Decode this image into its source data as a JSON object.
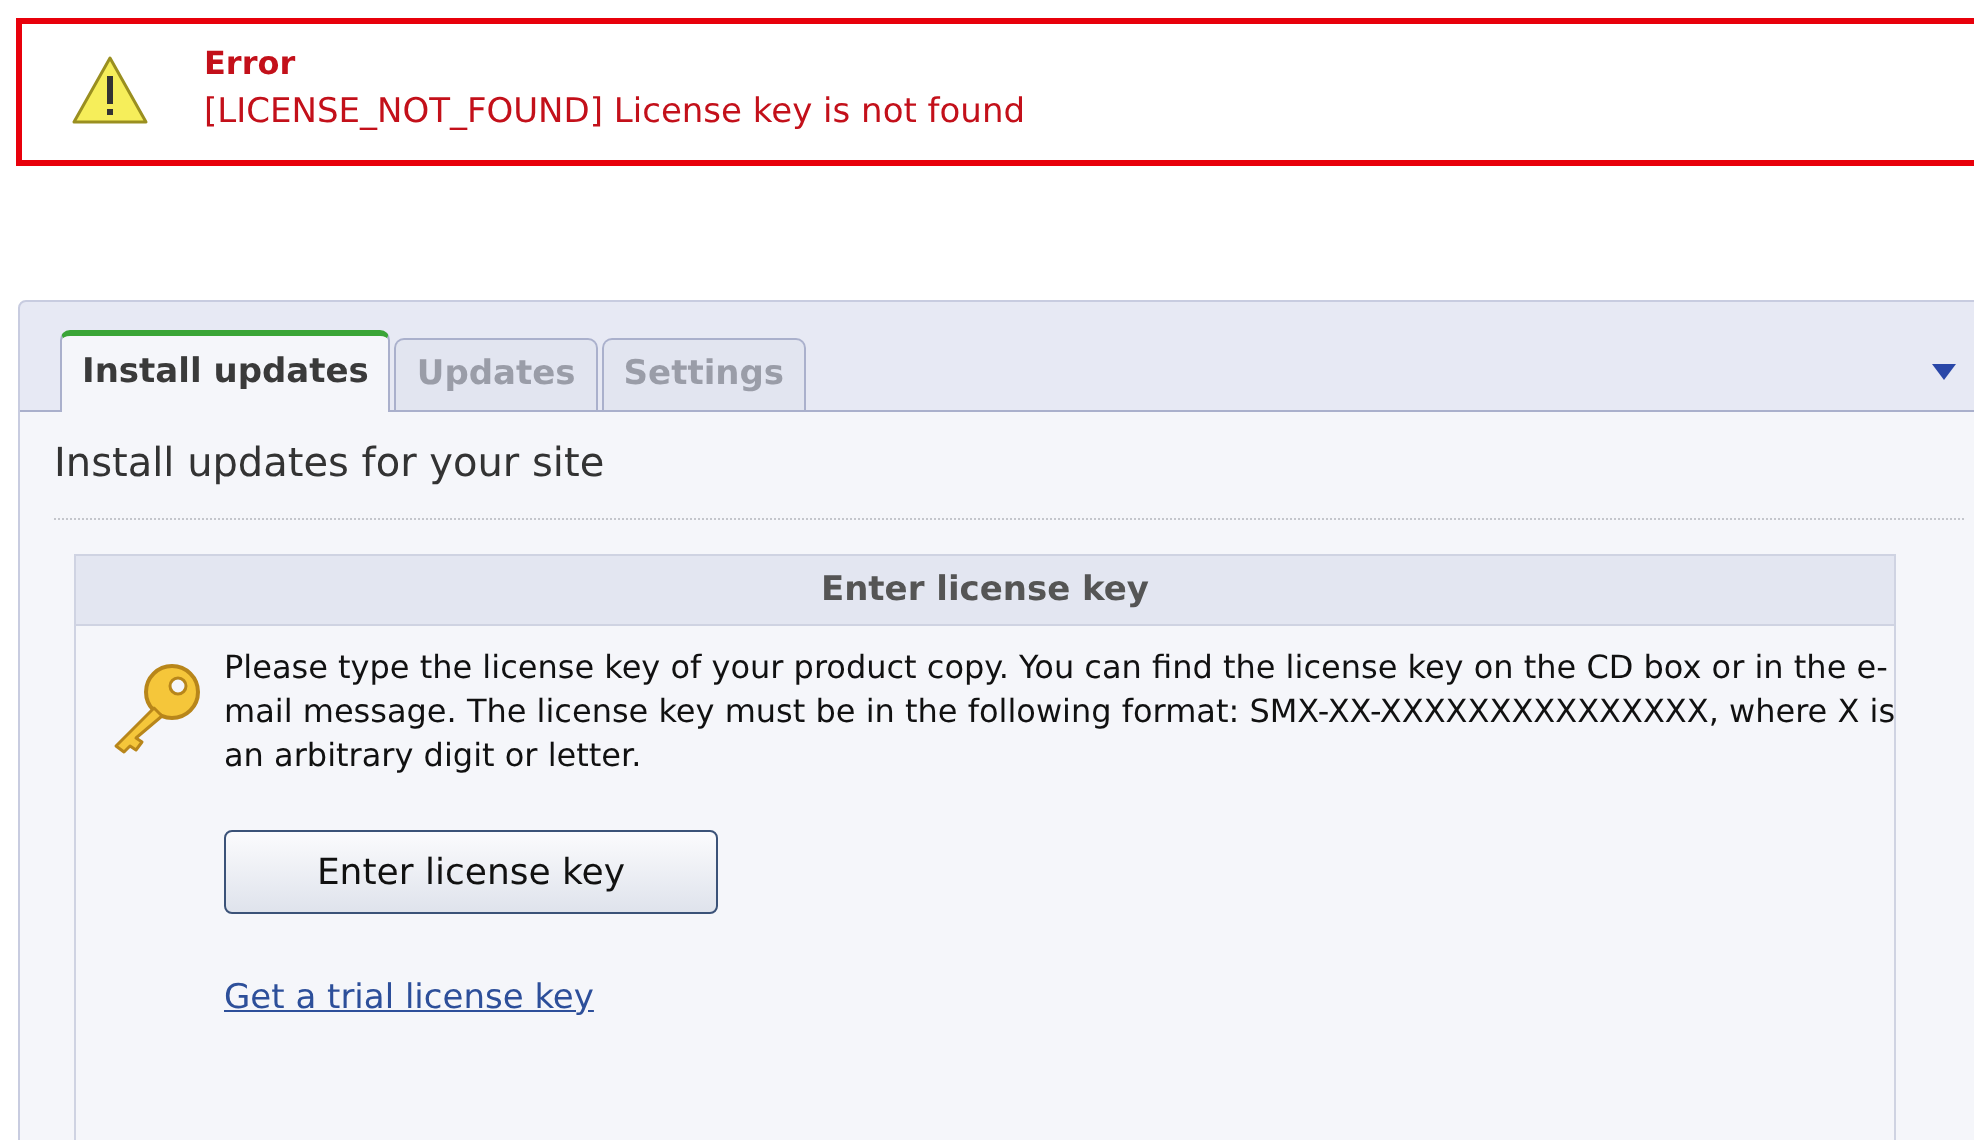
{
  "error": {
    "title": "Error",
    "message": "[LICENSE_NOT_FOUND] License key is not found"
  },
  "tabs": [
    {
      "label": "Install updates",
      "selected": true
    },
    {
      "label": "Updates",
      "selected": false
    },
    {
      "label": "Settings",
      "selected": false
    }
  ],
  "page_title": "Install updates for your site",
  "license_box": {
    "title": "Enter license key",
    "description": "Please type the license key of your product copy. You can find the license key on the CD box or in the e-mail message. The license key must be in the following format: SMX-XX-XXXXXXXXXXXXXXX, where X is an arbitrary digit or letter.",
    "button": "Enter license key",
    "link": "Get a trial license key"
  }
}
